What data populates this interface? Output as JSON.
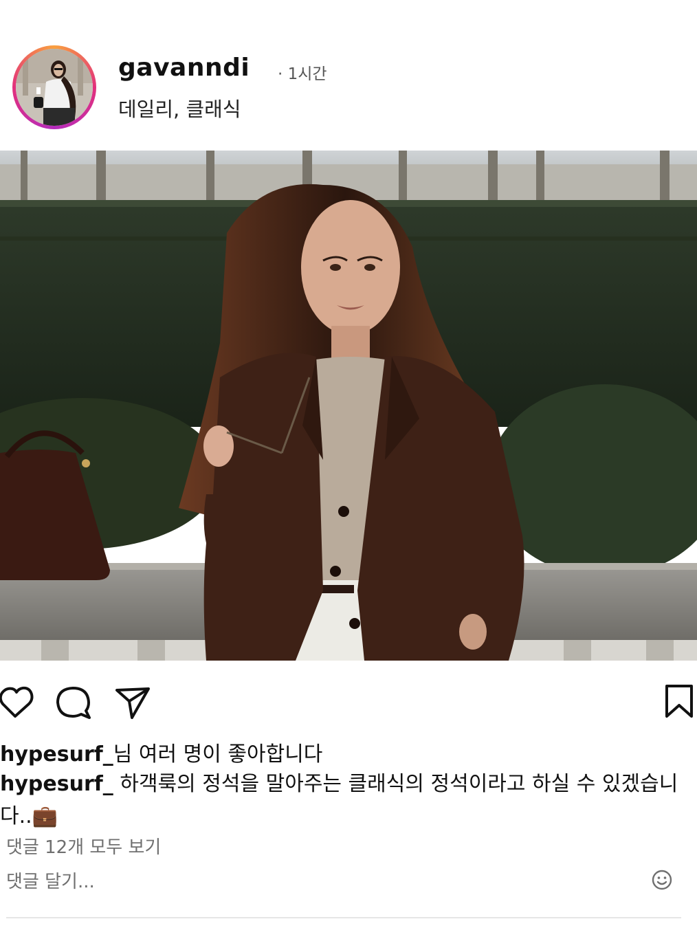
{
  "post": {
    "username": "gavanndi",
    "time": "· 1시간",
    "subtitle": "데일리, 클래식"
  },
  "icons": {
    "avatar": "profile-photo",
    "like": "heart-icon",
    "comment": "comment-bubble-icon",
    "share": "paper-plane-icon",
    "save": "bookmark-icon",
    "emoji": "smiley-icon",
    "caption_emoji": "briefcase-icon"
  },
  "likes": {
    "user": "hypesurf_",
    "suffix": "님 여러 명이 좋아합니다"
  },
  "caption": {
    "user": "hypesurf_",
    "text": "하객룩의 정석을 말아주는 클래식의 정석이라고 하실 수 있겠습니다..",
    "emoji": "💼"
  },
  "comments": {
    "view_all": "댓글 12개 모두 보기",
    "placeholder": "댓글 달기..."
  },
  "colors": {
    "ring_start": "#f9a03f",
    "ring_end": "#b52bbd",
    "jacket": "#3e2116",
    "hedge": "#1f2a1d"
  }
}
